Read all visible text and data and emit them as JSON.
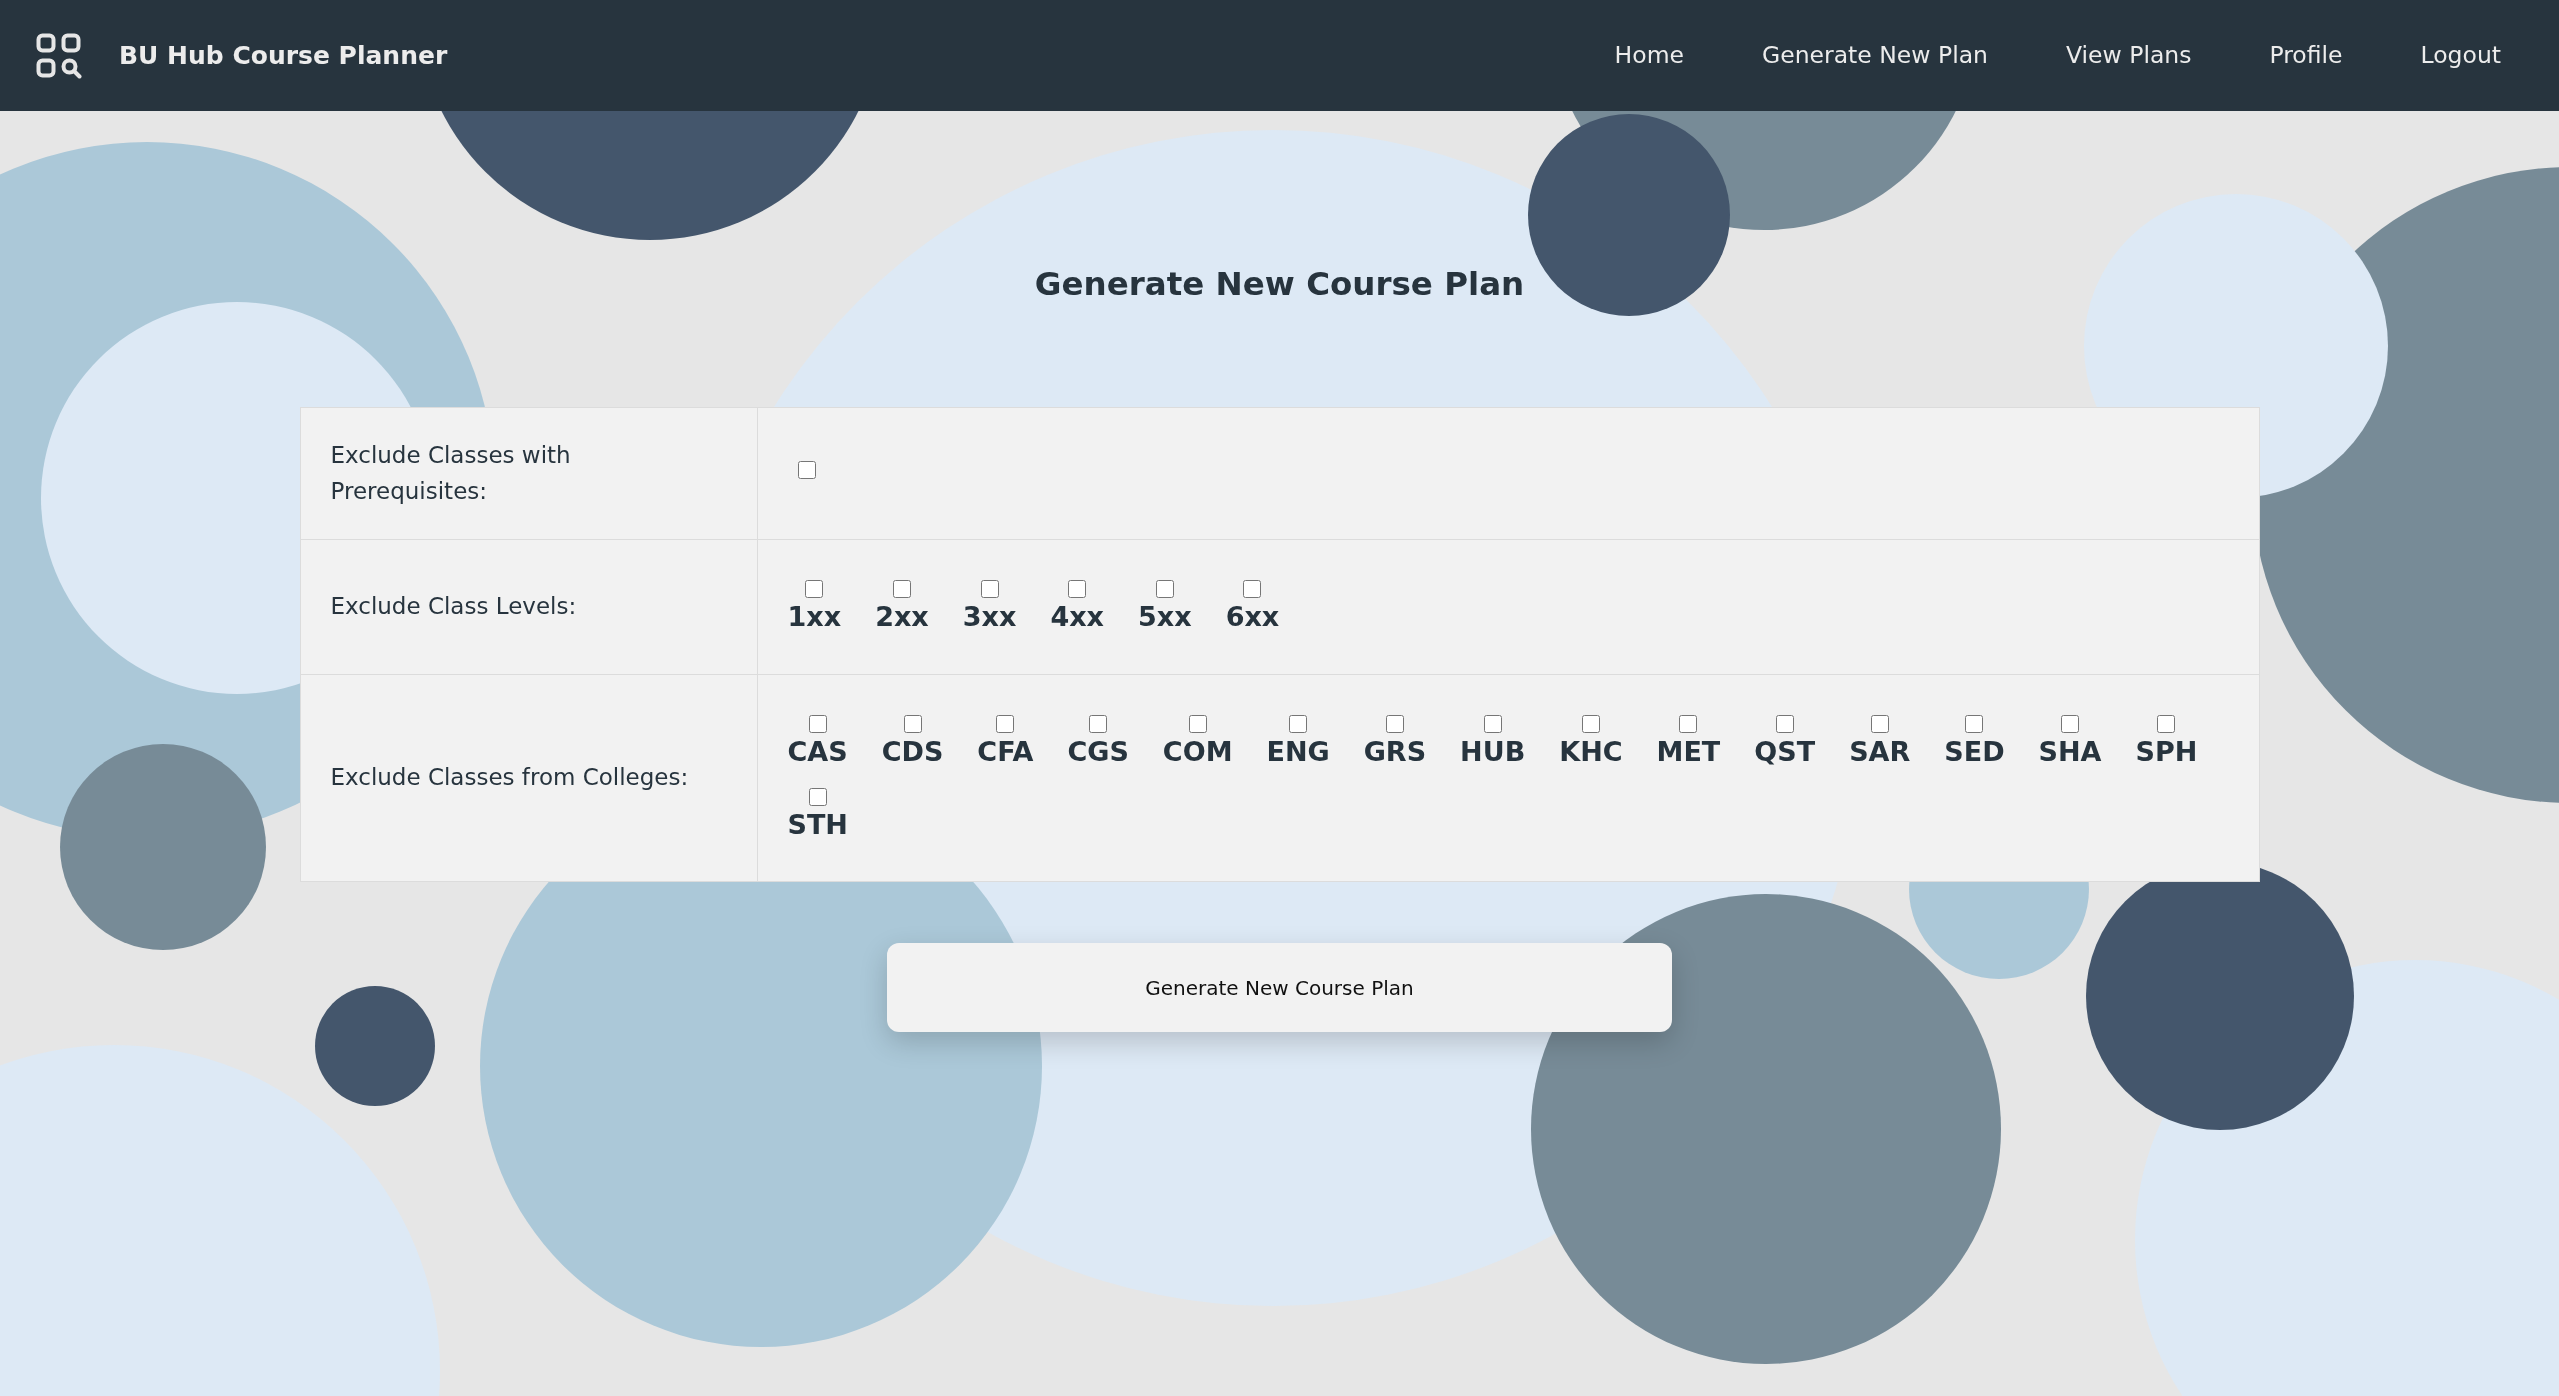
{
  "navbar": {
    "title": "BU Hub Course Planner",
    "links": [
      "Home",
      "Generate New Plan",
      "View Plans",
      "Profile",
      "Logout"
    ]
  },
  "heading": "Generate New Course Plan",
  "form": {
    "rows": [
      {
        "kind": "single",
        "label": "Exclude Classes with Prerequisites:",
        "checked": false
      },
      {
        "kind": "options",
        "label": "Exclude Class Levels:",
        "options": [
          {
            "label": "1xx",
            "checked": false
          },
          {
            "label": "2xx",
            "checked": false
          },
          {
            "label": "3xx",
            "checked": false
          },
          {
            "label": "4xx",
            "checked": false
          },
          {
            "label": "5xx",
            "checked": false
          },
          {
            "label": "6xx",
            "checked": false
          }
        ]
      },
      {
        "kind": "options",
        "label": "Exclude Classes from Colleges:",
        "options": [
          {
            "label": "CAS",
            "checked": false
          },
          {
            "label": "CDS",
            "checked": false
          },
          {
            "label": "CFA",
            "checked": false
          },
          {
            "label": "CGS",
            "checked": false
          },
          {
            "label": "COM",
            "checked": false
          },
          {
            "label": "ENG",
            "checked": false
          },
          {
            "label": "GRS",
            "checked": false
          },
          {
            "label": "HUB",
            "checked": false
          },
          {
            "label": "KHC",
            "checked": false
          },
          {
            "label": "MET",
            "checked": false
          },
          {
            "label": "QST",
            "checked": false
          },
          {
            "label": "SAR",
            "checked": false
          },
          {
            "label": "SED",
            "checked": false
          },
          {
            "label": "SHA",
            "checked": false
          },
          {
            "label": "SPH",
            "checked": false
          },
          {
            "label": "STH",
            "checked": false
          }
        ]
      }
    ]
  },
  "submit_button": "Generate New Course Plan"
}
